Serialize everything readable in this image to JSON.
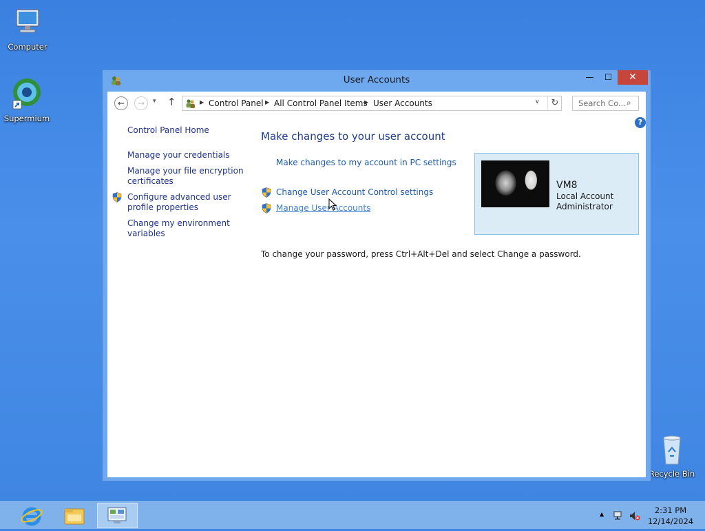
{
  "desktop": {
    "icons": [
      {
        "label": "Computer"
      },
      {
        "label": "Supermium"
      },
      {
        "label": "Recycle Bin"
      }
    ]
  },
  "window": {
    "title": "User Accounts",
    "controls": {
      "minimize": "—",
      "maximize": "☐",
      "close": "✕"
    },
    "nav": {
      "back": "←",
      "forward": "→",
      "recent": "▾",
      "up": "↑",
      "breadcrumb": [
        "Control Panel",
        "All Control Panel Items",
        "User Accounts"
      ],
      "separator": "▶",
      "dropdown": "∨",
      "refresh": "↻",
      "search_placeholder": "Search Co...",
      "search_icon": "⌕"
    },
    "help": "?",
    "sidebar": {
      "items": [
        {
          "label": "Control Panel Home"
        },
        {
          "label": "Manage your credentials"
        },
        {
          "label": "Manage your file encryption certificates",
          "line1": "Manage your file encryption",
          "line2": "certificates"
        },
        {
          "label": "Configure advanced user profile properties",
          "line1": "Configure advanced user",
          "line2": "profile properties",
          "icon": "uac-shield-icon"
        },
        {
          "label": "Change my environment variables",
          "line1": "Change my environment",
          "line2": "variables"
        }
      ]
    },
    "main": {
      "heading": "Make changes to your user account",
      "links": [
        {
          "label": "Make changes to my account in PC settings"
        },
        {
          "label": "Change User Account Control settings",
          "icon": "uac-shield-icon"
        },
        {
          "label": "Manage User Accounts",
          "icon": "uac-shield-icon"
        }
      ],
      "note": "To change your password, press Ctrl+Alt+Del and select Change a password."
    },
    "account": {
      "name": "VM8",
      "type": "Local Account",
      "role": "Administrator"
    }
  },
  "taskbar": {
    "apps": [
      "internet-explorer-icon",
      "file-explorer-icon",
      "control-panel-icon"
    ],
    "tray": {
      "chevron": "▲"
    },
    "clock": {
      "time": "2:31 PM",
      "date": "12/14/2024"
    }
  }
}
